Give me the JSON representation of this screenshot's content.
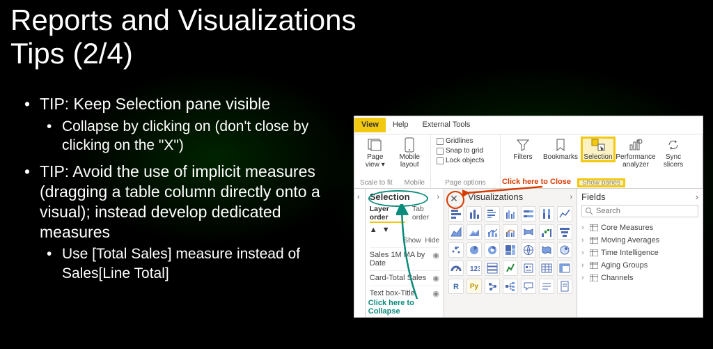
{
  "title_line1": "Reports and Visualizations",
  "title_line2": "Tips (2/4)",
  "bullets": {
    "tip1": "TIP: Keep Selection pane visible",
    "tip1_sub": "Collapse by clicking on (don't close by clicking on the \"X\")",
    "tip2": "TIP: Avoid the use of implicit measures (dragging a table column directly onto a visual); instead develop dedicated measures",
    "tip2_sub": "Use [Total Sales] measure instead of Sales[Line Total]"
  },
  "ribbon": {
    "tabs": {
      "view": "View",
      "help": "Help",
      "ext": "External Tools"
    },
    "groups": {
      "scale": {
        "page_view": "Page view",
        "mobile": "Mobile layout",
        "label": "Scale to fit",
        "label2": "Mobile"
      },
      "page_options": {
        "grid": "Gridlines",
        "snap": "Snap to grid",
        "lock": "Lock objects",
        "label": "Page options"
      },
      "show_panes": {
        "filters": "Filters",
        "bookmarks": "Bookmarks",
        "selection": "Selection",
        "perf": "Performance analyzer",
        "sync": "Sync slicers",
        "label": "Show panes"
      }
    }
  },
  "filters_tab": "Filters",
  "selection_pane": {
    "title": "Selection",
    "tabs": {
      "layer": "Layer order",
      "tab": "Tab order"
    },
    "show": "Show",
    "hide": "Hide",
    "items": [
      "Sales 1M MA by Date",
      "Card-Total Sales",
      "Text box-Title"
    ],
    "collapse_note": "Click here to Collapse"
  },
  "viz_pane": {
    "title": "Visualizations",
    "close_note": "Click here to Close"
  },
  "fields_pane": {
    "title": "Fields",
    "search_placeholder": "Search",
    "tables": [
      "Core Measures",
      "Moving Averages",
      "Time Intelligence",
      "Aging Groups",
      "Channels"
    ]
  }
}
